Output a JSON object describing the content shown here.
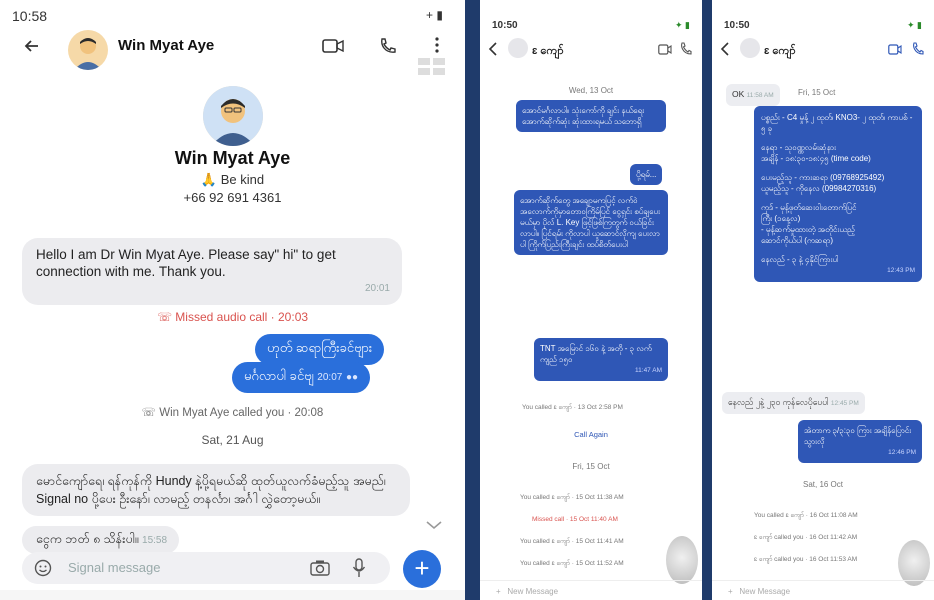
{
  "panel1": {
    "status_time": "10:58",
    "status_right": "+ ▮",
    "contact_name": "Win Myat Aye",
    "profile": {
      "name": "Win Myat Aye",
      "about": "🙏 Be kind",
      "phone": "+66 92 691 4361"
    },
    "messages": [
      {
        "text": "Hello I am Dr Win Myat Aye. Please say\" hi\" to get connection with me. Thank you.",
        "time": "20:01"
      }
    ],
    "missed_call": "Missed audio call · 20:03",
    "outgoing": [
      {
        "text": "ဟုတ် ဆရာကြီးခင်ဗျား"
      },
      {
        "text": "မင်္ဂလာပါ ခင်ဗျ",
        "time": "20:07"
      }
    ],
    "called_you": "Win Myat Aye called you · 20:08",
    "date_sep": "Sat, 21 Aug",
    "message2": "မောင်ကျော်ရေ၊ ရန်ကုန်ကို Hundy နဲ့ပို့ရမယ်ဆို ထုတ်ယူလက်ခံမည့်သူ အမည်၊ Signal no ပို့ပေး ဦးနော်၊ လာမည့် တနင်္လာ၊ အင်္ဂါ လွှဲတော့မယ်။",
    "message2b": "ငွေက ဘတ် ၈ သိန်းပါ။",
    "message2b_time": "15:58",
    "compose_placeholder": "Signal message"
  },
  "panel2": {
    "time": "10:50",
    "contact": "ɛ ကျော်",
    "date1": "Wed, 13 Oct",
    "bubble1": "အောင်မင်္ဂလာပါ။ သုံးကော်ကို ချင်း နယ်ရေး အောက်ဆိုက်ဆုံး ဆုံးထားရမယ် သဘောရှိ",
    "bubble2": "ပို့ရမ်...",
    "bubble3": "အောက်ဆိုက်တွေ အချောမကပြင့် လက်ဝဲ အလောက်ကိုမှာတောဝကြိမ်ပြင် ငွေရှင်း စပ်ချပေးမယ်မှာ ပိုလ် L. Key ဖြင့်ဖြစ်ကြတွက် ဝယ်ခြင်းလာပါ။ ပြင်ရမ်း ကိုလာပါ ယူဆောင်လိုကျ ပေးလာပါ ကြိုက်ပြည်းကြီးချင်း ထပ်စိတ်ပေးပါ",
    "bubble4": "TNT အမြောင် ၁၆၀ နဲ့ အတို - ၃ လက် ကျည် ၁၅၀",
    "bubble4_time": "11:47 AM",
    "call1": "You called ɛ ကျော် · 13 Oct 2:58 PM",
    "call_again": "Call Again",
    "date2": "Fri, 15 Oct",
    "call2": "You called ɛ ကျော် · 15 Oct 11:38 AM",
    "call3": "Missed call · 15 Oct 11:40 AM",
    "call4": "You called ɛ ကျော် · 15 Oct 11:41 AM",
    "call5": "You called ɛ ကျော် · 15 Oct 11:52 AM",
    "compose": "New Message"
  },
  "panel3": {
    "time": "10:50",
    "contact": "ɛ ကျော်",
    "ok_text": "OK",
    "ok_time": "11:58 AM",
    "date1": "Fri, 15 Oct",
    "bubble1_lines": [
      "ပစ္စည်း - C4 မှုန့် ၂ ထုတ်၊ KNO3- ၂ ထုတ်၊ ကာပစ် - ၅ ခု",
      "",
      "နေရာ - သုဝဏ္ဏလမ်းဆုံနား",
      "အချိန် - ၁၈:၃၀-၁၈:၄၅ (time code)",
      "",
      "ပေးမည့်သူ - ကားဆရာ (09768925492)",
      "ယူမည့်သူ - ကိုနေလ (09984270316)",
      "",
      "ကုဒ် - မုန့်ဖုတ်ဆေးဝါးတောက်ပြင်",
      "ကြီး (၁နေ့လ)",
      "      - မုန့်ဆက်မှုထားတဲ့ အတိုင်းယည့်",
      "ဆောင်ကိုယ်ပါ (ကဆရာ)",
      "",
      "နေလည် - ၃ နဲ့ ၄နိုင်ကြားပါ"
    ],
    "bubble1_time": "12:43 PM",
    "in_msg": "နေလည် ၂နဲ့ ၂၃၀ ကုန်လေပိုပေပါ",
    "in_msg_time": "12:45 PM",
    "bubble2": "အဲတာက ၃/၃:၃၀ ကြား အချိန်ပြောင်းသွားလို",
    "bubble2_time": "12:46 PM",
    "date2": "Sat, 16 Oct",
    "call1": "You called ɛ ကျော် · 16 Oct 11:08 AM",
    "call2": "ɛ ကျော် called you · 16 Oct 11:42 AM",
    "call3": "ɛ ကျော် called you · 16 Oct 11:53 AM",
    "compose": "New Message"
  }
}
